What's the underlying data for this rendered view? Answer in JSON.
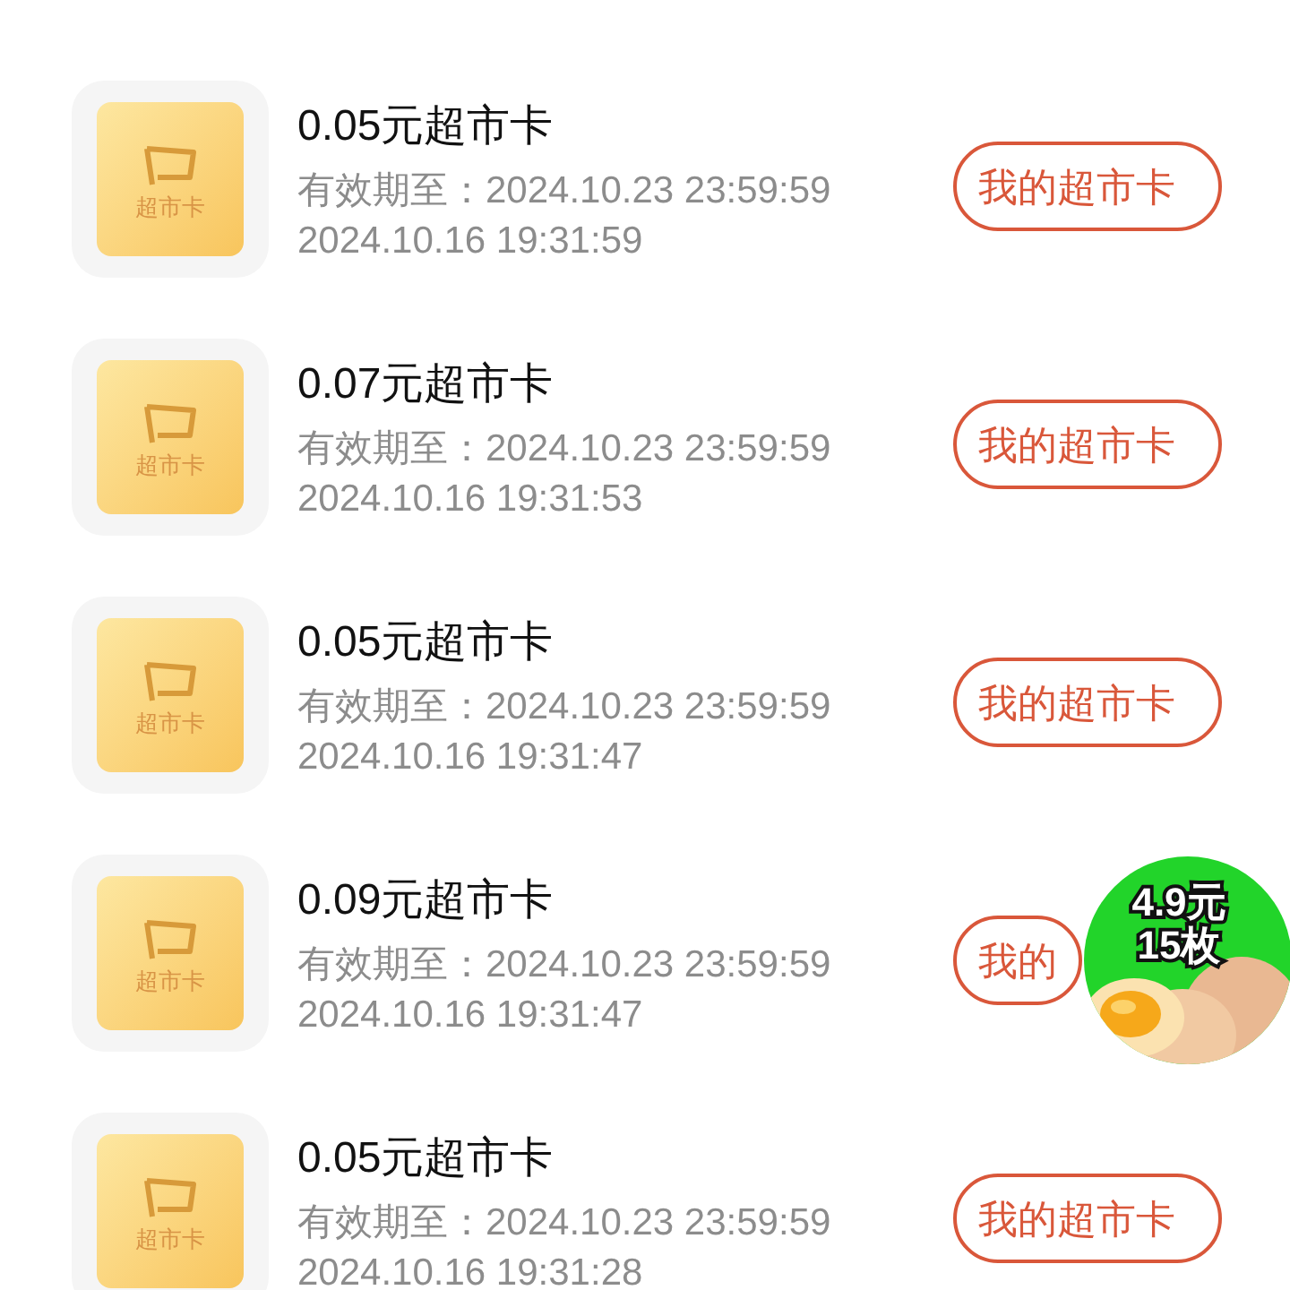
{
  "cards": [
    {
      "tile_label": "超市卡",
      "title": "0.05元超市卡",
      "expiry": "有效期至：2024.10.23 23:59:59",
      "time": "2024.10.16 19:31:59",
      "button": "我的超市卡"
    },
    {
      "tile_label": "超市卡",
      "title": "0.07元超市卡",
      "expiry": "有效期至：2024.10.23 23:59:59",
      "time": "2024.10.16 19:31:53",
      "button": "我的超市卡"
    },
    {
      "tile_label": "超市卡",
      "title": "0.05元超市卡",
      "expiry": "有效期至：2024.10.23 23:59:59",
      "time": "2024.10.16 19:31:47",
      "button": "我的超市卡"
    },
    {
      "tile_label": "超市卡",
      "title": "0.09元超市卡",
      "expiry": "有效期至：2024.10.23 23:59:59",
      "time": "2024.10.16 19:31:47",
      "button": "我的",
      "kind": "covered"
    },
    {
      "tile_label": "超市卡",
      "title": "0.05元超市卡",
      "expiry": "有效期至：2024.10.23 23:59:59",
      "time": "2024.10.16 19:31:28",
      "button": "我的超市卡"
    }
  ],
  "floating_ad": {
    "price": "4.9元",
    "count": "15枚"
  }
}
